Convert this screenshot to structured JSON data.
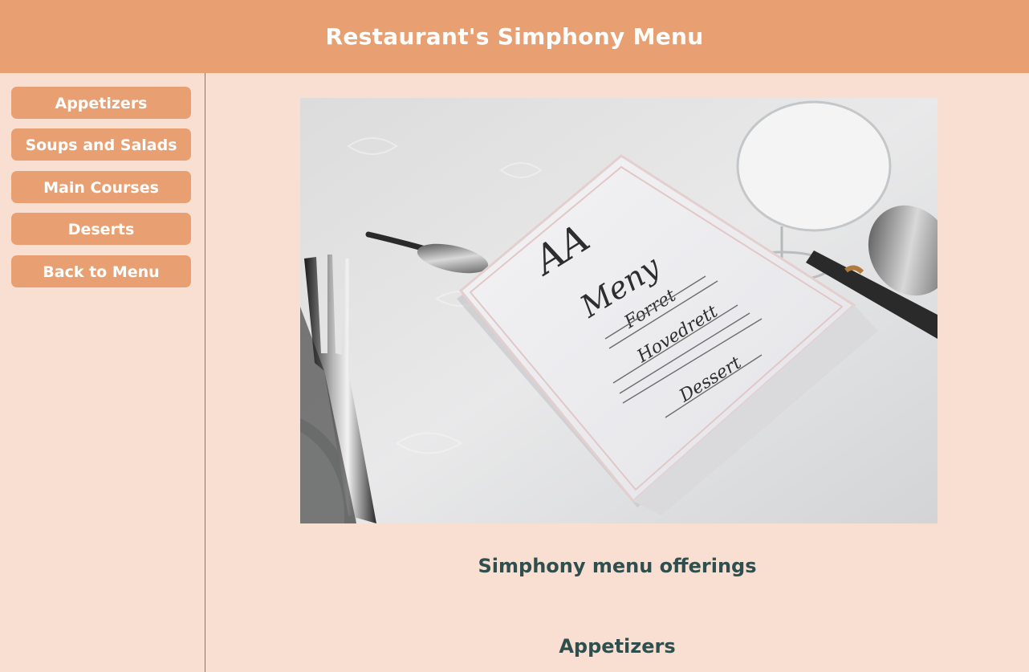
{
  "header": {
    "title": "Restaurant's Simphony Menu"
  },
  "sidebar": {
    "items": [
      {
        "label": "Appetizers"
      },
      {
        "label": "Soups and Salads"
      },
      {
        "label": "Main Courses"
      },
      {
        "label": "Deserts"
      },
      {
        "label": "Back to Menu"
      }
    ]
  },
  "main": {
    "section_title": "Simphony menu offerings",
    "subsection_title": "Appetizers",
    "photo": {
      "card_monogram": "AA",
      "card_title": "Meny",
      "card_section_1": "Forret",
      "card_section_2": "Hovedrett",
      "card_section_3": "Dessert"
    }
  },
  "colors": {
    "header_bg": "#e8a072",
    "page_bg": "#f9dfd1",
    "button_bg": "#e8a072",
    "heading_text": "#2f4f4f"
  }
}
